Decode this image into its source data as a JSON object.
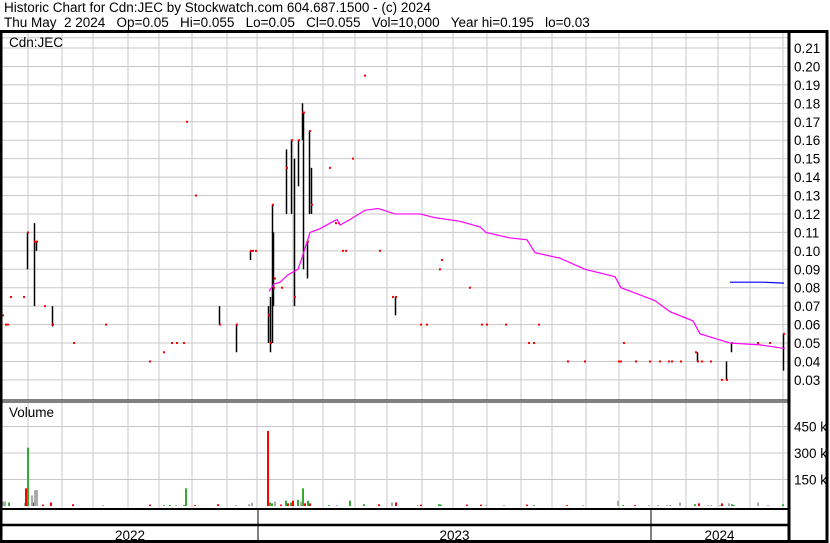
{
  "header": {
    "title": "Historic Chart for Cdn:JEC by Stockwatch.com 604.687.1500 - (c) 2024",
    "quote": "Thu May  2 2024   Op=0.05   Hi=0.055   Lo=0.05   Cl=0.055   Vol=10,000   Year hi=0.195   lo=0.03"
  },
  "chart_data": {
    "type": "bar",
    "symbol_label": "Cdn:JEC",
    "volume_label": "Volume",
    "x_unit": "session index",
    "x_range": [
      0,
      786
    ],
    "price_axis": {
      "ylim": [
        0.02,
        0.215
      ],
      "ticks": [
        "0.21",
        "0.20",
        "0.19",
        "0.18",
        "0.17",
        "0.16",
        "0.15",
        "0.14",
        "0.13",
        "0.12",
        "0.11",
        "0.10",
        "0.09",
        "0.08",
        "0.07",
        "0.06",
        "0.05",
        "0.04",
        "0.03"
      ]
    },
    "volume_axis": {
      "ylim": [
        0,
        500
      ],
      "unit": "k",
      "ticks": [
        "450 k",
        "300 k",
        "150 k"
      ],
      "tick_values": [
        450,
        300,
        150
      ]
    },
    "years": [
      {
        "label": "2022",
        "start": 0,
        "end": 256
      },
      {
        "label": "2023",
        "start": 256,
        "end": 649
      },
      {
        "label": "2024",
        "start": 649,
        "end": 786
      }
    ],
    "price_bars": [
      [
        25,
        0.09,
        0.11,
        0.11
      ],
      [
        32,
        0.07,
        0.115,
        0.105
      ],
      [
        34,
        0.1,
        0.105,
        0.105
      ],
      [
        50,
        0.059,
        0.07,
        0.06
      ],
      [
        217,
        0.06,
        0.07,
        0.06
      ],
      [
        234,
        0.045,
        0.06,
        0.06
      ],
      [
        248,
        0.095,
        0.1,
        0.1
      ],
      [
        266,
        0.05,
        0.07,
        0.065
      ],
      [
        268,
        0.045,
        0.075,
        0.05
      ],
      [
        270,
        0.05,
        0.125,
        0.125
      ],
      [
        271,
        0.07,
        0.11,
        0.08
      ],
      [
        284,
        0.12,
        0.155,
        0.145
      ],
      [
        289,
        0.12,
        0.16,
        0.16
      ],
      [
        292,
        0.07,
        0.15,
        0.075
      ],
      [
        296,
        0.135,
        0.16,
        0.16
      ],
      [
        300,
        0.16,
        0.18,
        0.175
      ],
      [
        301,
        0.09,
        0.175,
        0.175
      ],
      [
        305,
        0.085,
        0.105,
        0.105
      ],
      [
        307,
        0.12,
        0.165,
        0.165
      ],
      [
        309,
        0.12,
        0.145,
        0.125
      ],
      [
        393,
        0.065,
        0.075,
        0.075
      ],
      [
        695,
        0.04,
        0.045,
        0.04
      ],
      [
        724,
        0.03,
        0.04,
        0.03
      ],
      [
        729,
        0.045,
        0.05,
        0.05
      ],
      [
        781,
        0.035,
        0.055,
        0.055
      ]
    ],
    "price_dots": [
      [
        0,
        0.065
      ],
      [
        3,
        0.06
      ],
      [
        5,
        0.06
      ],
      [
        8,
        0.075
      ],
      [
        21,
        0.075
      ],
      [
        42,
        0.07
      ],
      [
        71,
        0.05
      ],
      [
        103,
        0.06
      ],
      [
        147,
        0.04
      ],
      [
        161,
        0.045
      ],
      [
        169,
        0.05
      ],
      [
        174,
        0.05
      ],
      [
        181,
        0.05
      ],
      [
        184,
        0.17
      ],
      [
        193,
        0.13
      ],
      [
        250,
        0.1
      ],
      [
        253,
        0.1
      ],
      [
        272,
        0.085
      ],
      [
        279,
        0.08
      ],
      [
        327,
        0.145
      ],
      [
        333,
        0.115
      ],
      [
        336,
        0.115
      ],
      [
        340,
        0.1
      ],
      [
        343,
        0.1
      ],
      [
        350,
        0.15
      ],
      [
        362,
        0.195
      ],
      [
        377,
        0.1
      ],
      [
        390,
        0.075
      ],
      [
        418,
        0.06
      ],
      [
        424,
        0.06
      ],
      [
        437,
        0.09
      ],
      [
        439,
        0.095
      ],
      [
        467,
        0.08
      ],
      [
        479,
        0.06
      ],
      [
        484,
        0.06
      ],
      [
        503,
        0.06
      ],
      [
        526,
        0.05
      ],
      [
        531,
        0.05
      ],
      [
        536,
        0.06
      ],
      [
        565,
        0.04
      ],
      [
        582,
        0.04
      ],
      [
        616,
        0.04
      ],
      [
        618,
        0.04
      ],
      [
        621,
        0.05
      ],
      [
        633,
        0.04
      ],
      [
        647,
        0.04
      ],
      [
        657,
        0.04
      ],
      [
        666,
        0.04
      ],
      [
        669,
        0.04
      ],
      [
        678,
        0.04
      ],
      [
        693,
        0.045
      ],
      [
        699,
        0.04
      ],
      [
        708,
        0.04
      ],
      [
        719,
        0.03
      ],
      [
        755,
        0.05
      ],
      [
        767,
        0.05
      ]
    ],
    "moving_average": [
      [
        267,
        0.078
      ],
      [
        272,
        0.082
      ],
      [
        278,
        0.083
      ],
      [
        286,
        0.087
      ],
      [
        296,
        0.09
      ],
      [
        301,
        0.098
      ],
      [
        308,
        0.11
      ],
      [
        318,
        0.112
      ],
      [
        328,
        0.115
      ],
      [
        335,
        0.117
      ],
      [
        338,
        0.114
      ],
      [
        348,
        0.117
      ],
      [
        363,
        0.122
      ],
      [
        376,
        0.123
      ],
      [
        393,
        0.12
      ],
      [
        418,
        0.12
      ],
      [
        433,
        0.118
      ],
      [
        458,
        0.116
      ],
      [
        478,
        0.113
      ],
      [
        484,
        0.11
      ],
      [
        508,
        0.107
      ],
      [
        525,
        0.106
      ],
      [
        533,
        0.099
      ],
      [
        558,
        0.096
      ],
      [
        583,
        0.09
      ],
      [
        613,
        0.086
      ],
      [
        619,
        0.08
      ],
      [
        653,
        0.073
      ],
      [
        668,
        0.067
      ],
      [
        691,
        0.062
      ],
      [
        698,
        0.055
      ],
      [
        728,
        0.05
      ],
      [
        758,
        0.049
      ],
      [
        783,
        0.047
      ]
    ],
    "reference_line": [
      [
        728,
        0.083
      ],
      [
        761,
        0.083
      ],
      [
        782,
        0.0825
      ]
    ],
    "volume": [
      [
        0,
        25,
        "gray"
      ],
      [
        2,
        25,
        "gray"
      ],
      [
        6,
        20,
        "green"
      ],
      [
        22,
        18,
        "gray"
      ],
      [
        23,
        100,
        "red"
      ],
      [
        25,
        330,
        "green"
      ],
      [
        29,
        60,
        "gray"
      ],
      [
        31,
        20,
        "red"
      ],
      [
        32,
        90,
        "gray"
      ],
      [
        34,
        90,
        "gray"
      ],
      [
        40,
        8,
        "red"
      ],
      [
        48,
        20,
        "red"
      ],
      [
        70,
        10,
        "red"
      ],
      [
        100,
        3,
        "green"
      ],
      [
        147,
        8,
        "red"
      ],
      [
        161,
        5,
        "green"
      ],
      [
        167,
        5,
        "green"
      ],
      [
        173,
        5,
        "gray"
      ],
      [
        181,
        5,
        "green"
      ],
      [
        183,
        100,
        "green"
      ],
      [
        192,
        5,
        "red"
      ],
      [
        215,
        10,
        "red"
      ],
      [
        233,
        5,
        "gray"
      ],
      [
        246,
        10,
        "gray"
      ],
      [
        249,
        18,
        "gray"
      ],
      [
        265,
        425,
        "red"
      ],
      [
        267,
        20,
        "green"
      ],
      [
        269,
        15,
        "green"
      ],
      [
        272,
        25,
        "gray"
      ],
      [
        278,
        8,
        "red"
      ],
      [
        283,
        30,
        "green"
      ],
      [
        285,
        15,
        "red"
      ],
      [
        288,
        20,
        "green"
      ],
      [
        290,
        30,
        "red"
      ],
      [
        295,
        35,
        "green"
      ],
      [
        298,
        25,
        "gray"
      ],
      [
        300,
        100,
        "green"
      ],
      [
        302,
        15,
        "red"
      ],
      [
        305,
        30,
        "green"
      ],
      [
        307,
        15,
        "red"
      ],
      [
        326,
        5,
        "green"
      ],
      [
        334,
        5,
        "gray"
      ],
      [
        347,
        30,
        "green"
      ],
      [
        361,
        10,
        "green"
      ],
      [
        376,
        10,
        "red"
      ],
      [
        389,
        20,
        "gray"
      ],
      [
        393,
        20,
        "red"
      ],
      [
        415,
        5,
        "gray"
      ],
      [
        418,
        8,
        "red"
      ],
      [
        436,
        10,
        "green"
      ],
      [
        437,
        10,
        "green"
      ],
      [
        438,
        5,
        "green"
      ],
      [
        464,
        8,
        "red"
      ],
      [
        478,
        8,
        "red"
      ],
      [
        483,
        5,
        "gray"
      ],
      [
        501,
        5,
        "gray"
      ],
      [
        524,
        8,
        "red"
      ],
      [
        531,
        5,
        "green"
      ],
      [
        564,
        5,
        "red"
      ],
      [
        580,
        5,
        "gray"
      ],
      [
        615,
        30,
        "gray"
      ],
      [
        620,
        5,
        "green"
      ],
      [
        632,
        5,
        "red"
      ],
      [
        646,
        5,
        "gray"
      ],
      [
        655,
        5,
        "gray"
      ],
      [
        664,
        5,
        "gray"
      ],
      [
        667,
        5,
        "gray"
      ],
      [
        677,
        20,
        "gray"
      ],
      [
        692,
        10,
        "green"
      ],
      [
        696,
        15,
        "red"
      ],
      [
        705,
        5,
        "gray"
      ],
      [
        708,
        5,
        "gray"
      ],
      [
        717,
        5,
        "gray"
      ],
      [
        719,
        15,
        "red"
      ],
      [
        726,
        15,
        "gray"
      ],
      [
        729,
        10,
        "green"
      ],
      [
        731,
        5,
        "green"
      ],
      [
        755,
        20,
        "gray"
      ],
      [
        765,
        5,
        "gray"
      ],
      [
        780,
        10,
        "green"
      ]
    ],
    "colors": {
      "up": "#33aa33",
      "down": "#ff0000",
      "flat": "#aaaaaa",
      "bar": "#000000",
      "dot": "#ff0000",
      "ma": "#ff00ff",
      "ref": "#0000ff",
      "grid": "#c8c8c8"
    }
  }
}
